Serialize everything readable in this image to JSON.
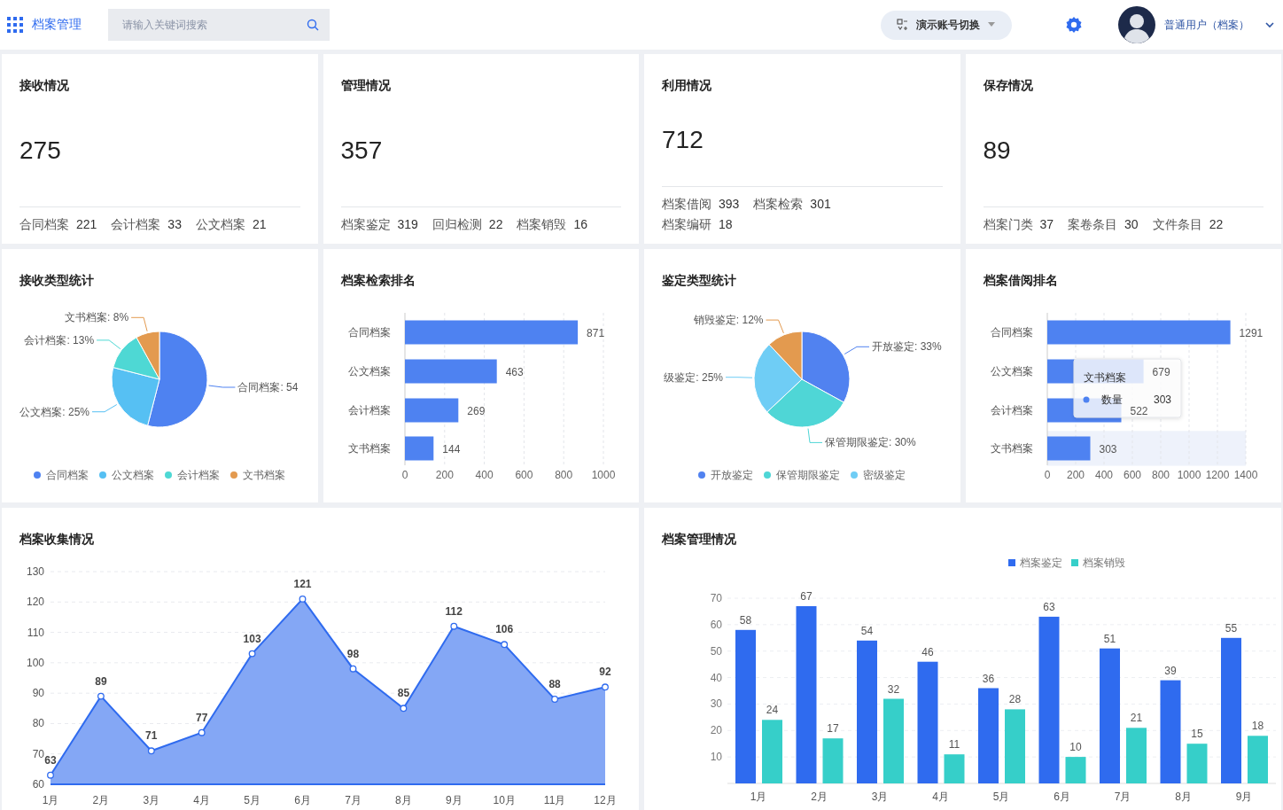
{
  "header": {
    "app_title": "档案管理",
    "search": {
      "placeholder": "请输入关键词搜索"
    },
    "account_switch": "演示账号切换",
    "user_name": "普通用户（档案）"
  },
  "stat_cards": [
    {
      "title": "接收情况",
      "value": "275",
      "item_rows": [
        [
          {
            "label": "合同档案",
            "value": "221"
          },
          {
            "label": "会计档案",
            "value": "33"
          },
          {
            "label": "公文档案",
            "value": "21"
          }
        ]
      ]
    },
    {
      "title": "管理情况",
      "value": "357",
      "item_rows": [
        [
          {
            "label": "档案鉴定",
            "value": "319"
          },
          {
            "label": "回归检测",
            "value": "22"
          },
          {
            "label": "档案销毁",
            "value": "16"
          }
        ]
      ]
    },
    {
      "title": "利用情况",
      "value": "712",
      "item_rows": [
        [
          {
            "label": "档案借阅",
            "value": "393"
          },
          {
            "label": "档案检索",
            "value": "301"
          }
        ],
        [
          {
            "label": "档案编研",
            "value": "18"
          }
        ]
      ]
    },
    {
      "title": "保存情况",
      "value": "89",
      "item_rows": [
        [
          {
            "label": "档案门类",
            "value": "37"
          },
          {
            "label": "案卷条目",
            "value": "30"
          },
          {
            "label": "文件条目",
            "value": "22"
          }
        ]
      ]
    }
  ],
  "panels": [
    {
      "title": "接收类型统计",
      "legend": [
        {
          "name": "合同档案",
          "color": "#4e82f1"
        },
        {
          "name": "公文档案",
          "color": "#56c0f3"
        },
        {
          "name": "会计档案",
          "color": "#4ed8d4"
        },
        {
          "name": "文书档案",
          "color": "#e39a4f"
        }
      ],
      "chart_data": {
        "type": "pie",
        "values": [
          54,
          25,
          13,
          8
        ],
        "colors": [
          "#4e82f1",
          "#56c0f3",
          "#4ed8d4",
          "#e39a4f"
        ],
        "value_labels": [
          "合同档案: 54",
          "公文档案: 25%",
          "会计档案: 13%",
          "文书档案: 8%"
        ]
      }
    },
    {
      "title": "档案检索排名",
      "chart_data": {
        "type": "bar",
        "orientation": "horizontal",
        "categories": [
          "合同档案",
          "公文档案",
          "会计档案",
          "文书档案"
        ],
        "series": [
          {
            "color": "#4e82f1",
            "values": [
              871,
              463,
              269,
              144
            ]
          }
        ],
        "xlim": [
          0,
          1000
        ],
        "xticks": [
          0,
          200,
          400,
          600,
          800,
          1000
        ],
        "grid": true,
        "data_labels": true
      }
    },
    {
      "title": "鉴定类型统计",
      "legend": [
        {
          "name": "开放鉴定",
          "color": "#5182f0"
        },
        {
          "name": "保管期限鉴定",
          "color": "#4fd6d6"
        },
        {
          "name": "密级鉴定",
          "color": "#6fcdf5"
        }
      ],
      "chart_data": {
        "type": "pie",
        "values": [
          33,
          30,
          25,
          12
        ],
        "colors": [
          "#5182f0",
          "#4fd6d6",
          "#6fcdf5",
          "#e39a4f"
        ],
        "value_labels": [
          "开放鉴定: 33%",
          "保管期限鉴定: 30%",
          "级鉴定: 25%",
          "销毁鉴定: 12%"
        ]
      }
    },
    {
      "title": "档案借阅排名",
      "tooltip": {
        "title": "文书档案",
        "value": "303"
      },
      "chart_data": {
        "type": "bar",
        "orientation": "horizontal",
        "bands": [
          {
            "axis": "y",
            "from": "文书档案",
            "to": "文书档案",
            "color": "#eef2fb"
          }
        ],
        "categories": [
          "合同档案",
          "公文档案",
          "会计档案",
          "文书档案"
        ],
        "series": [
          {
            "name": "数量",
            "color": "#4e82f1",
            "values": [
              1291,
              679,
              522,
              303
            ]
          }
        ],
        "xlim": [
          0,
          1400
        ],
        "xticks": [
          0,
          200,
          400,
          600,
          800,
          1000,
          1200,
          1400
        ],
        "grid": true,
        "data_labels": true
      }
    },
    {
      "title": "档案收集情况",
      "chart_data": {
        "type": "area",
        "categories": [
          "1月",
          "2月",
          "3月",
          "4月",
          "5月",
          "6月",
          "7月",
          "8月",
          "9月",
          "10月",
          "11月",
          "12月"
        ],
        "values": [
          63,
          89,
          71,
          77,
          103,
          121,
          98,
          85,
          112,
          106,
          88,
          92
        ],
        "ylim": [
          60,
          130
        ],
        "yticks": [
          60,
          70,
          80,
          90,
          100,
          110,
          120,
          130
        ],
        "grid": true,
        "data_labels": true
      }
    },
    {
      "title": "档案管理情况",
      "chart_data": {
        "type": "bar",
        "orientation": "vertical",
        "categories": [
          "1月",
          "2月",
          "3月",
          "4月",
          "5月",
          "6月",
          "7月",
          "8月",
          "9月"
        ],
        "series": [
          {
            "name": "档案鉴定",
            "color": "#2f6bef",
            "values": [
              58,
              67,
              54,
              46,
              36,
              63,
              51,
              39,
              55
            ]
          },
          {
            "name": "档案销毁",
            "color": "#36cfc9",
            "values": [
              24,
              17,
              32,
              11,
              28,
              10,
              21,
              15,
              18
            ]
          }
        ],
        "ylim": [
          0,
          70
        ],
        "yticks": [
          10,
          20,
          30,
          40,
          50,
          60,
          70
        ],
        "grid": true,
        "data_labels": true
      }
    }
  ]
}
